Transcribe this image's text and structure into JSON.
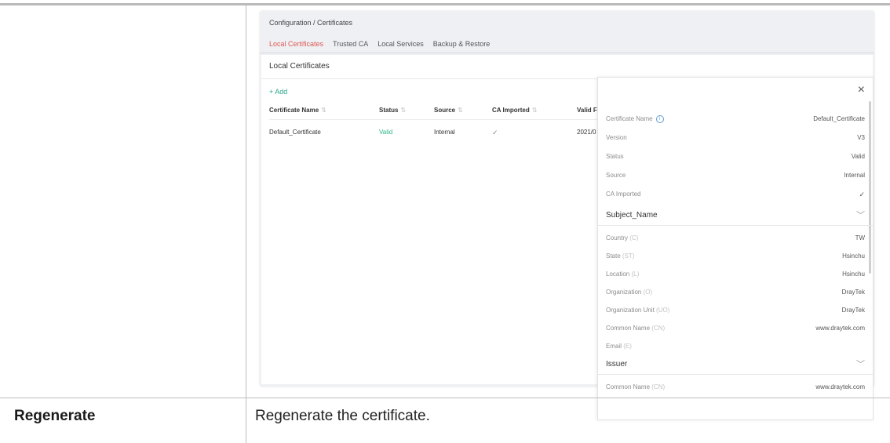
{
  "doc_row": {
    "label": "Regenerate",
    "description": "Regenerate the certificate."
  },
  "app": {
    "breadcrumb": "Configuration / Certificates",
    "tabs": [
      {
        "label": "Local Certificates",
        "active": true
      },
      {
        "label": "Trusted CA",
        "active": false
      },
      {
        "label": "Local Services",
        "active": false
      },
      {
        "label": "Backup & Restore",
        "active": false
      }
    ],
    "card_title": "Local Certificates",
    "add_label": "+ Add",
    "table": {
      "columns": [
        "Certificate Name",
        "Status",
        "Source",
        "CA Imported",
        "Valid F"
      ],
      "sort_icon": "⇅",
      "rows": [
        {
          "name": "Default_Certificate",
          "status": "Valid",
          "source": "Internal",
          "ca_imported": "✓",
          "valid_from": "2021/0"
        }
      ]
    }
  },
  "drawer": {
    "close_icon": "×",
    "fields": [
      {
        "key": "Certificate Name",
        "value": "Default_Certificate"
      },
      {
        "key": "Version",
        "value": "V3"
      },
      {
        "key": "Status",
        "value": "Valid"
      },
      {
        "key": "Source",
        "value": "Internal"
      },
      {
        "key": "CA Imported",
        "value": "✓"
      }
    ],
    "subject_title": "Subject_Name",
    "chevron": "﹀",
    "subject_fields": [
      {
        "key": "Country",
        "abbr": "(C)",
        "value": "TW"
      },
      {
        "key": "State",
        "abbr": "(ST)",
        "value": "Hsinchu"
      },
      {
        "key": "Location",
        "abbr": "(L)",
        "value": "Hsinchu"
      },
      {
        "key": "Organization",
        "abbr": "(O)",
        "value": "DrayTek"
      },
      {
        "key": "Organization Unit",
        "abbr": "(UO)",
        "value": "DrayTek"
      },
      {
        "key": "Common Name",
        "abbr": "(CN)",
        "value": "www.draytek.com"
      },
      {
        "key": "Email",
        "abbr": "(E)",
        "value": ""
      }
    ],
    "issuer_title": "Issuer",
    "issuer_fields": [
      {
        "key": "Common Name",
        "abbr": "(CN)",
        "value": "www.draytek.com"
      }
    ]
  },
  "colors": {
    "accent_tab": "#e0574e",
    "valid_green": "#2bb38a",
    "add_green": "#2aa68a"
  }
}
